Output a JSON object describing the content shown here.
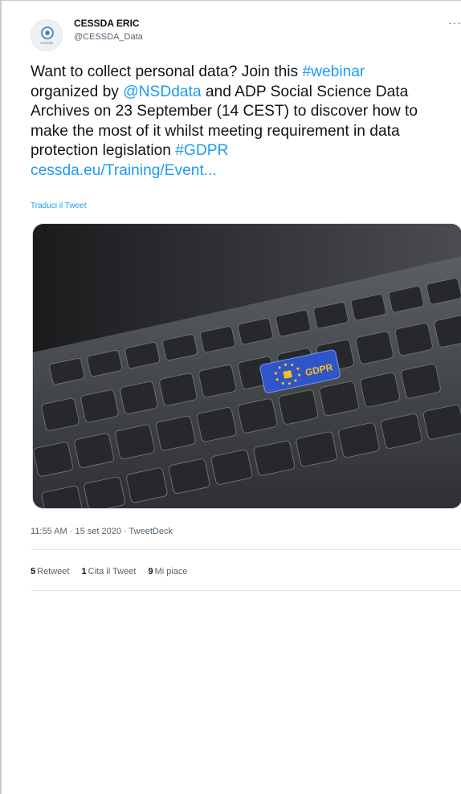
{
  "author": {
    "name": "CESSDA ERIC",
    "handle": "@CESSDA_Data",
    "avatar_icon": "cessda-logo-icon",
    "avatar_text": "cessda"
  },
  "more_label": "···",
  "tweet": {
    "segments": [
      [
        "Want to collect personal data? Join this ",
        "#webinar"
      ],
      [
        "organized by ",
        "@NSDdata",
        " and ADP Social Science Data"
      ],
      [
        "Archives on 23 September (14 CEST) to discover how to"
      ],
      [
        "make the most of it whilst meeting requirement in data"
      ],
      [
        "protection legislation ",
        "#GDPR"
      ],
      [
        "cessda.eu/Training/Event..."
      ]
    ],
    "hashtag_webinar": "#webinar",
    "mention": "@NSDdata",
    "hashtag_gdpr": "#GDPR",
    "url": "cessda.eu/Training/Event...",
    "text_part_1": "Want to collect personal data? Join this ",
    "text_part_2": "organized by ",
    "text_part_3": " and ADP Social Science Data",
    "text_part_4": "Archives on 23 September (14 CEST) to discover how to",
    "text_part_5": "make the most of it whilst meeting requirement in data",
    "text_part_6": "protection legislation "
  },
  "translate_label": "Traduci il Tweet",
  "media": {
    "image_subject": "laptop keyboard with blue GDPR key",
    "key_label": "GDPR"
  },
  "meta": {
    "time": "11:55 AM",
    "date": "15 set 2020",
    "source": "TweetDeck",
    "sep": " · "
  },
  "stats": {
    "retweets_count": "5",
    "retweets_label": "Retweet",
    "quotes_count": "1",
    "quotes_label": "Cita il Tweet",
    "likes_count": "9",
    "likes_label": "Mi piace"
  },
  "colors": {
    "link": "#1d9bf0",
    "text": "#0f1419",
    "secondary": "#536471",
    "gdpr_key": "#2f55c8"
  }
}
